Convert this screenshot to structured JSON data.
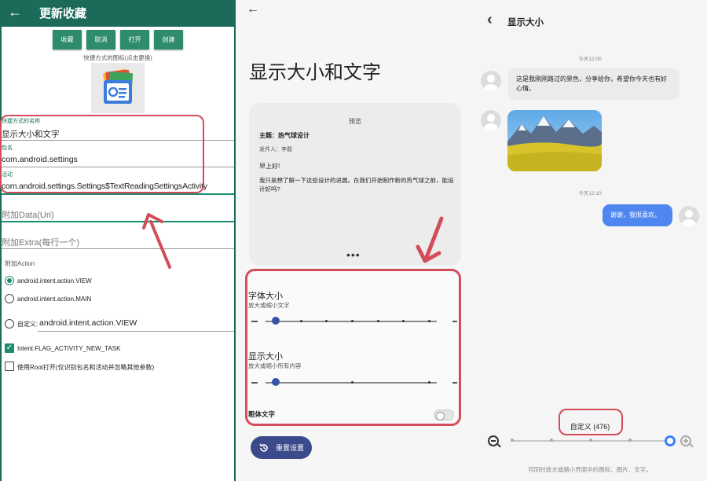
{
  "left_panel": {
    "header_title": "更新收藏",
    "buttons": [
      "收藏",
      "取消",
      "打开",
      "创建"
    ],
    "icon_hint": "快捷方式的图标(点击更换)",
    "fields": {
      "name_label": "快捷方式的名称",
      "name_value": "显示大小和文字",
      "package_label": "包名",
      "package_value": "com.android.settings",
      "activity_label": "活动",
      "activity_value": "com.android.settings.Settings$TextReadingSettingsActivity",
      "data_placeholder": "附加Data(Uri)",
      "extra_placeholder": "附加Extra(每行一个)"
    },
    "action_section": "附加Action",
    "actions": [
      {
        "label": "android.intent.action.VIEW",
        "selected": true
      },
      {
        "label": "android.intent.action.MAIN",
        "selected": false
      }
    ],
    "custom_label": "自定义:",
    "custom_value": "android.intent.action.VIEW",
    "checkboxes": [
      {
        "label": "Intent.FLAG_ACTIVITY_NEW_TASK",
        "checked": true
      },
      {
        "label": "使用Root打开(仅识别包名和活动并忽略其他参数)",
        "checked": false
      }
    ],
    "accent": "#1c6b5a"
  },
  "middle_panel": {
    "title": "显示大小和文字",
    "preview_label": "预览",
    "subject": "主题：热气球设计",
    "sender": "发件人：李磊",
    "greeting": "早上好!",
    "body": "我只是想了解一下这些设计的进展。在我们开始制作新的热气球之前，能设计好吗?",
    "font_size_title": "字体大小",
    "font_size_sub": "放大或缩小文字",
    "font_size_level": 0,
    "display_size_title": "显示大小",
    "display_size_sub": "放大或缩小所有内容",
    "display_size_level": 0,
    "bold_label": "粗体文字",
    "bold_on": false,
    "reset_label": "重置设置"
  },
  "right_panel": {
    "title": "显示大小",
    "timestamp1": "今天12:00",
    "message_in": "这是我刚刚路过的景色，分享给你，希望你今天也有好心情。",
    "timestamp2": "今天12:10",
    "message_out": "谢谢，我很喜欢。",
    "zoom_label": "自定义 (476)",
    "zoom_level_fraction": 1.0,
    "hint": "可同时放大或缩小界面中的图标、图片、文字。"
  },
  "colors": {
    "highlight_red": "#d24d57",
    "blue_bubble": "#4f86f0",
    "reset_button": "#3b4a8a"
  }
}
